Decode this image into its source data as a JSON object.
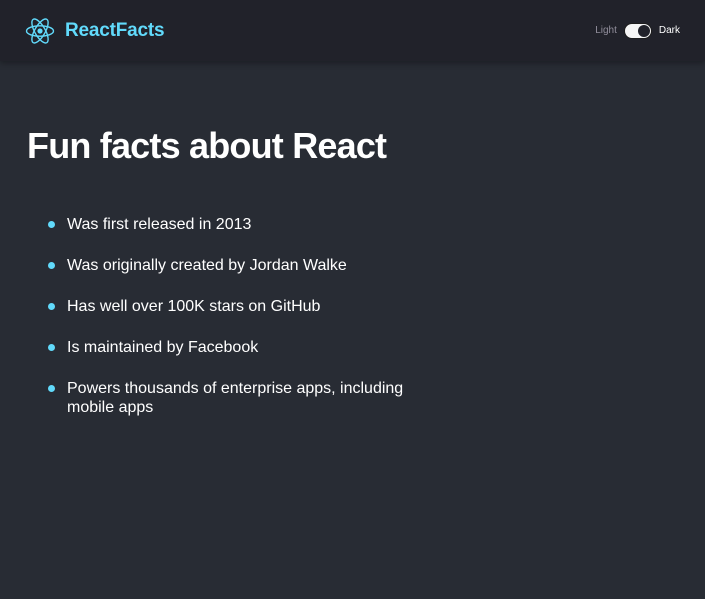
{
  "navbar": {
    "brand_name": "ReactFacts",
    "logo_icon": "react-atom-icon",
    "mode": {
      "light_label": "Light",
      "dark_label": "Dark",
      "active": "dark"
    }
  },
  "main": {
    "title": "Fun facts about React",
    "facts": [
      "Was first released in 2013",
      "Was originally created by Jordan Walke",
      "Has well over 100K stars on GitHub",
      "Is maintained by Facebook",
      "Powers thousands of enterprise apps, including mobile apps"
    ]
  },
  "colors": {
    "accent": "#61dafb",
    "background": "#282c34",
    "navbar_background": "#21222a",
    "text": "#ffffff",
    "muted_text": "#918e9b"
  }
}
